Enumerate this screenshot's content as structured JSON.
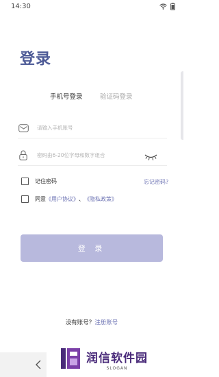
{
  "status_bar": {
    "time": "14:30",
    "wifi_icon": "wifi-icon",
    "battery_icon": "battery-icon"
  },
  "page_title": "登录",
  "tabs": [
    {
      "label": "手机号登录",
      "active": true
    },
    {
      "label": "验证码登录",
      "active": false
    }
  ],
  "phone_field": {
    "placeholder": "请输入手机账号",
    "icon": "mail-icon"
  },
  "password_field": {
    "placeholder": "密码由6-20位字母和数字组合",
    "icon": "lock-icon",
    "toggle_icon": "closed-eye-icon"
  },
  "remember": {
    "label": "记住密码",
    "checked": false
  },
  "forgot_link": "忘记密码?",
  "agreement": {
    "prefix": "同意",
    "user_agreement": "《用户协议》",
    "separator": "、",
    "privacy_policy": "《隐私政策》",
    "checked": false
  },
  "login_button": "登 录",
  "register": {
    "prompt": "没有账号？",
    "link": "注册账号"
  },
  "watermark": {
    "name": "润信软件园",
    "slogan": "SLOGAN"
  },
  "colors": {
    "accent": "#4d5a96",
    "button": "#b8b9dd",
    "link": "#6e74b4"
  }
}
